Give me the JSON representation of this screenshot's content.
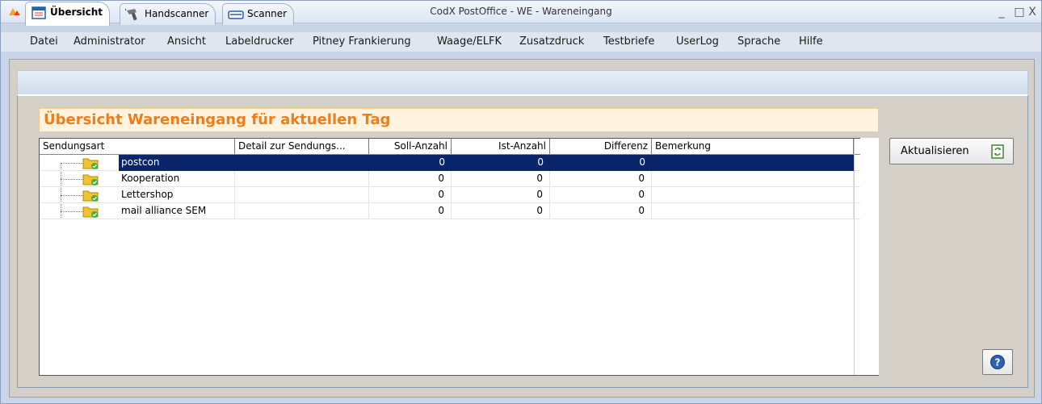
{
  "window": {
    "title": "CodX PostOffice - WE - Wareneingang",
    "minimize": "_",
    "maximize": "□",
    "close": "X"
  },
  "menu": [
    "Datei",
    "Administrator",
    "Ansicht",
    "Labeldrucker",
    "Pitney Frankierung",
    "Waage/ELFK",
    "Zusatzdruck",
    "Testbriefe",
    "UserLog",
    "Sprache",
    "Hilfe"
  ],
  "tabs": [
    {
      "label": "Übersicht",
      "icon": "calendar-icon",
      "active": true
    },
    {
      "label": "Handscanner",
      "icon": "handscanner-icon",
      "active": false
    },
    {
      "label": "Scanner",
      "icon": "scanner-icon",
      "active": false
    }
  ],
  "section_title": "Übersicht Wareneingang für aktuellen Tag",
  "grid": {
    "columns": [
      "Sendungsart",
      "Detail zur Sendungs...",
      "Soll-Anzahl",
      "Ist-Anzahl",
      "Differenz",
      "Bemerkung"
    ],
    "rows": [
      {
        "sendungsart": "postcon",
        "detail": "",
        "soll": "0",
        "ist": "0",
        "differenz": "0",
        "bemerkung": "",
        "selected": true
      },
      {
        "sendungsart": "Kooperation",
        "detail": "",
        "soll": "0",
        "ist": "0",
        "differenz": "0",
        "bemerkung": "",
        "selected": false
      },
      {
        "sendungsart": "Lettershop",
        "detail": "",
        "soll": "0",
        "ist": "0",
        "differenz": "0",
        "bemerkung": "",
        "selected": false
      },
      {
        "sendungsart": "mail alliance SEM",
        "detail": "",
        "soll": "0",
        "ist": "0",
        "differenz": "0",
        "bemerkung": "",
        "selected": false
      }
    ]
  },
  "buttons": {
    "refresh": "Aktualisieren"
  },
  "colors": {
    "accent_orange": "#ee7d1a",
    "selection": "#0a246a",
    "header_bg": "#fff4e2"
  }
}
